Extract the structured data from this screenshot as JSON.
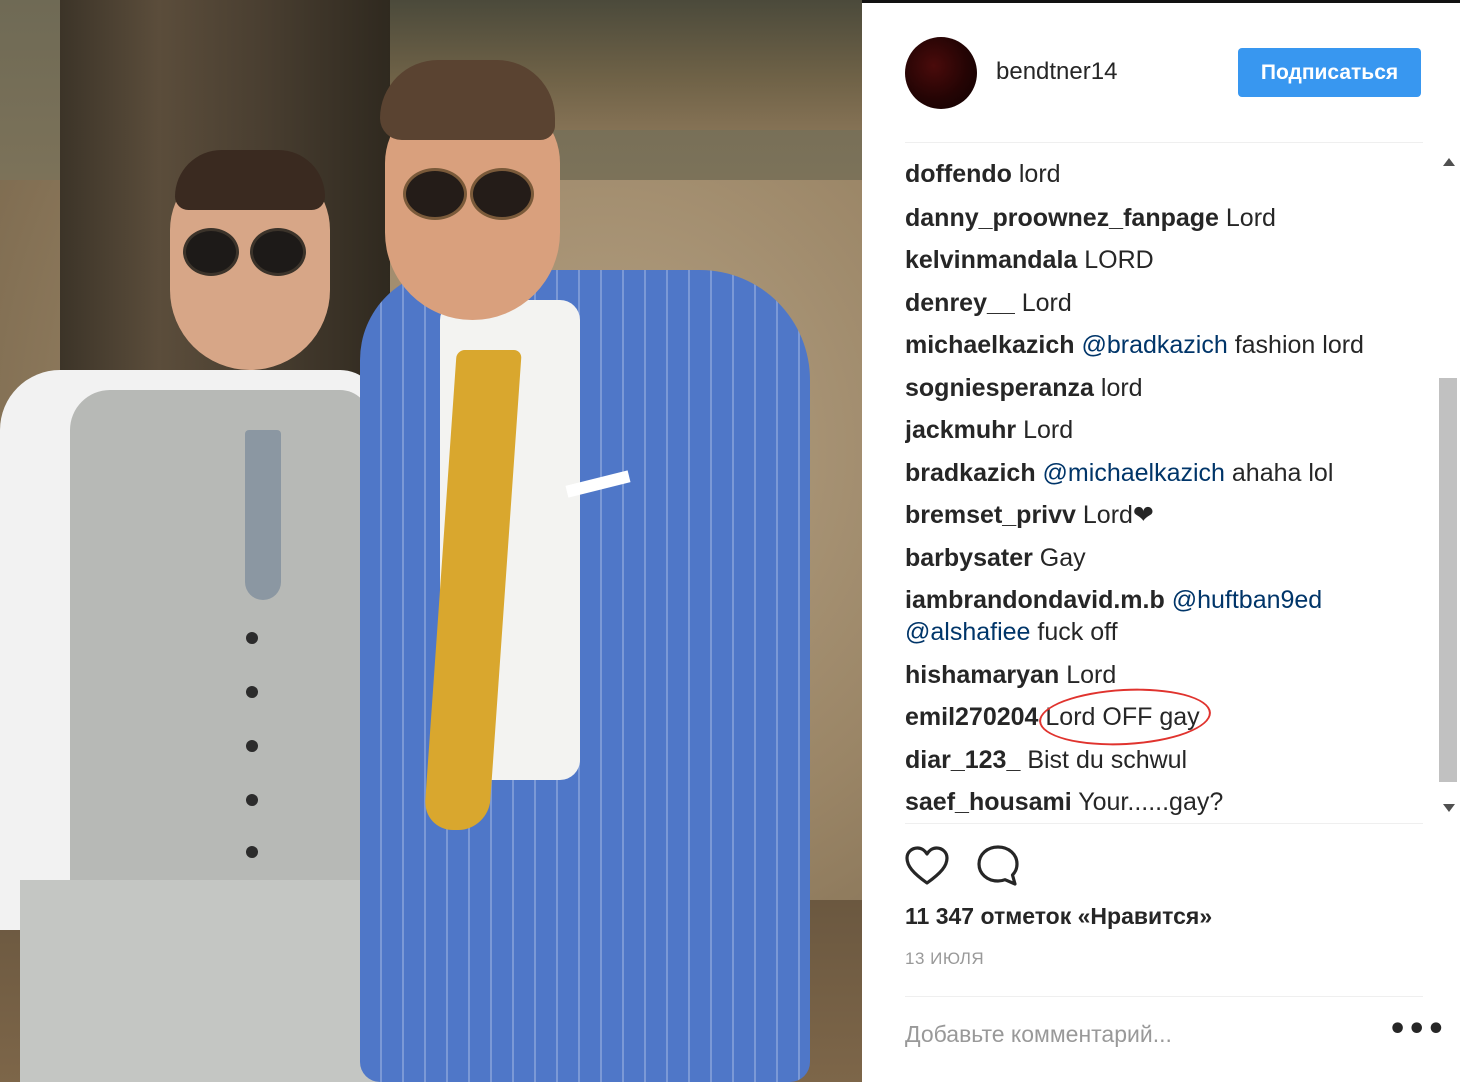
{
  "post": {
    "username": "bendtner14",
    "follow_label": "Подписаться",
    "likes": "11 347 отметок «Нравится»",
    "date": "13 ИЮЛЯ",
    "add_comment_placeholder": "Добавьте комментарий...",
    "more_label": "•••"
  },
  "comments": [
    {
      "user": "doffendo",
      "text": " lord"
    },
    {
      "user": "danny_proownez_fanpage",
      "text": " Lord"
    },
    {
      "user": "kelvinmandala",
      "text": " LORD"
    },
    {
      "user": "denrey__",
      "text": " Lord"
    },
    {
      "user": "michaelkazich",
      "mention": " @bradkazich",
      "text": " fashion lord"
    },
    {
      "user": "sogniesperanza",
      "text": " lord"
    },
    {
      "user": "jackmuhr",
      "text": " Lord"
    },
    {
      "user": "bradkazich",
      "mention": " @michaelkazich",
      "text": " ahaha lol"
    },
    {
      "user": "bremset_privv",
      "text": " Lord",
      "emoji": "❤"
    },
    {
      "user": "barbysater",
      "text": " Gay"
    },
    {
      "user": "iambrandondavid.m.b",
      "mention": " @huftban9ed",
      "mention2": "@alshafiee",
      "text2": " fuck off"
    },
    {
      "user": "hishamaryan",
      "text": " Lord"
    },
    {
      "user": "emil270204",
      "text": " Lord OFF gay"
    },
    {
      "user": "diar_123_",
      "text": " Bist du schwul"
    },
    {
      "user": "saef_housami",
      "text": " Your......gay?"
    }
  ],
  "icons": {
    "like": "heart-icon",
    "comment": "comment-icon",
    "scroll_up": "scroll-up-arrow-icon",
    "scroll_down": "scroll-down-arrow-icon"
  },
  "colors": {
    "follow_button": "#3897f0",
    "mention": "#003569",
    "highlight_ring": "#e0332e",
    "text": "#262626",
    "muted": "#999999"
  }
}
